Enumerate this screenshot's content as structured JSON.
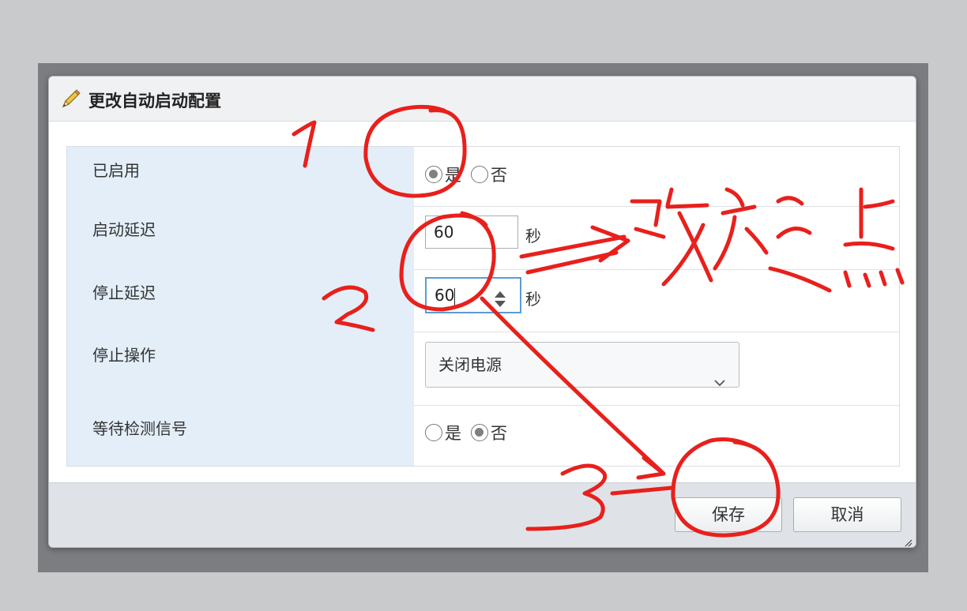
{
  "dialog": {
    "title": "更改自动启动配置",
    "title_icon": "pencil-icon"
  },
  "form": {
    "enabled": {
      "label": "已启用",
      "options": [
        "是",
        "否"
      ],
      "selected": "是"
    },
    "start_delay": {
      "label": "启动延迟",
      "value": "60",
      "unit": "秒"
    },
    "stop_delay": {
      "label": "停止延迟",
      "value": "60",
      "unit": "秒"
    },
    "stop_action": {
      "label": "停止操作",
      "selected": "关闭电源"
    },
    "wait_heartbeat": {
      "label": "等待检测信号",
      "options": [
        "是",
        "否"
      ],
      "selected": "否"
    }
  },
  "footer": {
    "save_label": "保存",
    "cancel_label": "取消"
  },
  "annotations": {
    "color": "#e8201c",
    "steps": [
      "1",
      "2",
      "3"
    ],
    "note": "改短点"
  },
  "colors": {
    "label_bg": "#e3eef8",
    "footer_bg": "#dfe3e8",
    "focus_border": "#5b9bd5"
  }
}
